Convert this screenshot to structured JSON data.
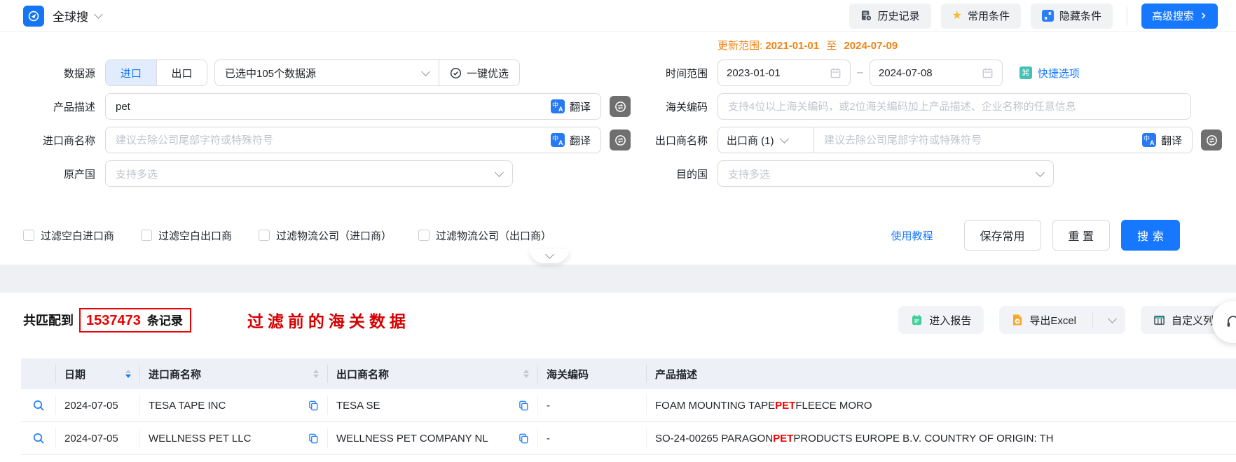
{
  "colors": {
    "accent_blue": "#1677ff",
    "update_orange": "#f08519",
    "alert_red": "#ea0000"
  },
  "topbar": {
    "app_title": "全球搜",
    "history_label": "历史记录",
    "favorites_label": "常用条件",
    "hide_label": "隐藏条件",
    "advanced_label": "高级搜索"
  },
  "form": {
    "update_range": {
      "label": "更新范围:",
      "start": "2021-01-01",
      "to": "至",
      "end": "2024-07-09"
    },
    "data_source": {
      "label": "数据源",
      "import_tab": "进口",
      "export_tab": "出口",
      "selected_text": "已选中105个数据源",
      "optimize_label": "一键优选"
    },
    "time_range": {
      "label": "时间范围",
      "start": "2023-01-01",
      "separator": "–",
      "end": "2024-07-08",
      "quick_label": "快捷选项"
    },
    "product_desc": {
      "label": "产品描述",
      "value": "pet",
      "translate_label": "翻译"
    },
    "hs_code": {
      "label": "海关编码",
      "placeholder": "支持4位以上海关编码，或2位海关编码加上产品描述、企业名称的任意信息"
    },
    "importer": {
      "label": "进口商名称",
      "placeholder": "建议去除公司尾部字符或特殊符号",
      "translate_label": "翻译"
    },
    "exporter": {
      "label": "出口商名称",
      "type_selector": "出口商 (1)",
      "placeholder": "建议去除公司尾部字符或特殊符号",
      "translate_label": "翻译"
    },
    "origin_country": {
      "label": "原产国",
      "placeholder": "支持多选"
    },
    "dest_country": {
      "label": "目的国",
      "placeholder": "支持多选"
    },
    "checkboxes": [
      "过滤空白进口商",
      "过滤空白出口商",
      "过滤物流公司（进口商）",
      "过滤物流公司（出口商）"
    ],
    "actions": {
      "tutorial": "使用教程",
      "save": "保存常用",
      "reset": "重 置",
      "search": "搜索"
    }
  },
  "results": {
    "match_prefix": "共匹配到",
    "match_count": "1537473",
    "match_suffix": "条记录",
    "annotation": "过滤前的海关数据",
    "report_label": "进入报告",
    "export_label": "导出Excel",
    "custom_columns_label": "自定义列",
    "table": {
      "headers": [
        "日期",
        "进口商名称",
        "出口商名称",
        "海关编码",
        "产品描述"
      ],
      "rows": [
        {
          "date": "2024-07-05",
          "importer": "TESA TAPE INC",
          "exporter": "TESA SE",
          "hs_code": "-",
          "desc_pre": "FOAM MOUNTING TAPE ",
          "desc_highlight": "PET",
          "desc_post": " FLEECE MORO"
        },
        {
          "date": "2024-07-05",
          "importer": "WELLNESS PET LLC",
          "exporter": "WELLNESS PET COMPANY NL",
          "hs_code": "-",
          "desc_pre": "SO-24-00265 PARAGON ",
          "desc_highlight": "PET",
          "desc_post": " PRODUCTS EUROPE B.V. COUNTRY OF ORIGIN: TH"
        }
      ]
    }
  },
  "icons": {
    "command_glyph": "⌘",
    "star_glyph": "★"
  }
}
